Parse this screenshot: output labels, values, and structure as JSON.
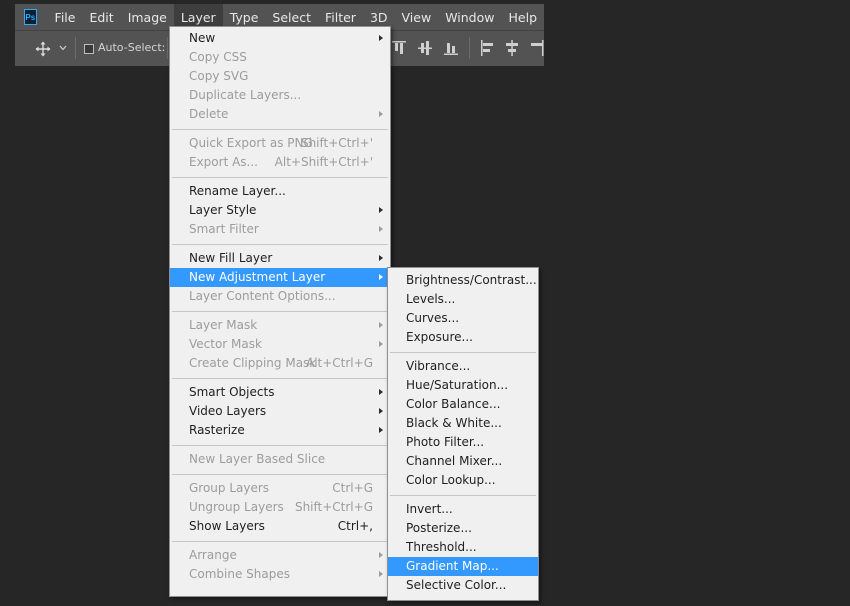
{
  "menubar": {
    "logo": "Ps",
    "items": [
      "File",
      "Edit",
      "Image",
      "Layer",
      "Type",
      "Select",
      "Filter",
      "3D",
      "View",
      "Window",
      "Help"
    ],
    "active_index": 3
  },
  "options_bar": {
    "auto_select_label": "Auto-Select:"
  },
  "layer_menu": {
    "groups": [
      [
        {
          "label": "New",
          "submenu": true
        },
        {
          "label": "Copy CSS",
          "disabled": true
        },
        {
          "label": "Copy SVG",
          "disabled": true
        },
        {
          "label": "Duplicate Layers...",
          "disabled": true
        },
        {
          "label": "Delete",
          "disabled": true,
          "submenu": true
        }
      ],
      [
        {
          "label": "Quick Export as PNG",
          "shortcut": "Shift+Ctrl+'",
          "disabled": true
        },
        {
          "label": "Export As...",
          "shortcut": "Alt+Shift+Ctrl+'",
          "disabled": true
        }
      ],
      [
        {
          "label": "Rename Layer..."
        },
        {
          "label": "Layer Style",
          "submenu": true
        },
        {
          "label": "Smart Filter",
          "disabled": true,
          "submenu": true
        }
      ],
      [
        {
          "label": "New Fill Layer",
          "submenu": true
        },
        {
          "label": "New Adjustment Layer",
          "submenu": true,
          "highlighted": true
        },
        {
          "label": "Layer Content Options...",
          "disabled": true
        }
      ],
      [
        {
          "label": "Layer Mask",
          "disabled": true,
          "submenu": true
        },
        {
          "label": "Vector Mask",
          "disabled": true,
          "submenu": true
        },
        {
          "label": "Create Clipping Mask",
          "shortcut": "Alt+Ctrl+G",
          "disabled": true
        }
      ],
      [
        {
          "label": "Smart Objects",
          "submenu": true
        },
        {
          "label": "Video Layers",
          "submenu": true
        },
        {
          "label": "Rasterize",
          "submenu": true
        }
      ],
      [
        {
          "label": "New Layer Based Slice",
          "disabled": true
        }
      ],
      [
        {
          "label": "Group Layers",
          "shortcut": "Ctrl+G",
          "disabled": true
        },
        {
          "label": "Ungroup Layers",
          "shortcut": "Shift+Ctrl+G",
          "disabled": true
        },
        {
          "label": "Show Layers",
          "shortcut": "Ctrl+,"
        }
      ],
      [
        {
          "label": "Arrange",
          "disabled": true,
          "submenu": true
        },
        {
          "label": "Combine Shapes",
          "disabled": true,
          "submenu": true
        }
      ]
    ]
  },
  "adjustment_menu": {
    "groups": [
      [
        {
          "label": "Brightness/Contrast..."
        },
        {
          "label": "Levels..."
        },
        {
          "label": "Curves..."
        },
        {
          "label": "Exposure..."
        }
      ],
      [
        {
          "label": "Vibrance..."
        },
        {
          "label": "Hue/Saturation..."
        },
        {
          "label": "Color Balance..."
        },
        {
          "label": "Black & White..."
        },
        {
          "label": "Photo Filter..."
        },
        {
          "label": "Channel Mixer..."
        },
        {
          "label": "Color Lookup..."
        }
      ],
      [
        {
          "label": "Invert..."
        },
        {
          "label": "Posterize..."
        },
        {
          "label": "Threshold..."
        },
        {
          "label": "Gradient Map...",
          "highlighted": true
        },
        {
          "label": "Selective Color..."
        }
      ]
    ]
  },
  "colors": {
    "highlight": "#3399ff",
    "menu_bg": "#f0f0f0",
    "chrome": "#535353",
    "canvas": "#262626"
  }
}
